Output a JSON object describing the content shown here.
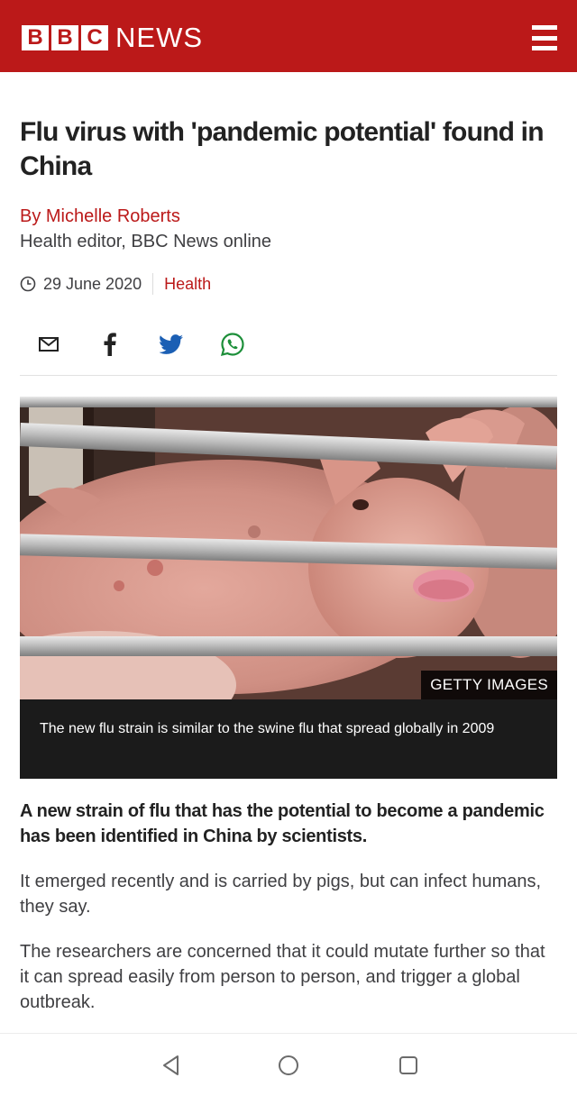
{
  "header": {
    "logo_letters": [
      "B",
      "B",
      "C"
    ],
    "logo_word": "NEWS",
    "menu_icon": "hamburger-menu-icon",
    "background_color": "#bb1919"
  },
  "article": {
    "headline": "Flu virus with 'pandemic potential' found in China",
    "author": "By Michelle Roberts",
    "author_role": "Health editor, BBC News online",
    "date": "29 June 2020",
    "section": "Health",
    "share_icons": [
      "email-icon",
      "facebook-icon",
      "twitter-icon",
      "whatsapp-icon"
    ]
  },
  "media": {
    "image_subject": "pig-behind-metal-bars",
    "credit": "GETTY IMAGES",
    "caption": "The new flu strain is similar to the swine flu that spread globally in 2009"
  },
  "body": {
    "intro": "A new strain of flu that has the potential to become a pandemic has been identified in China by scientists.",
    "paragraphs": [
      "It emerged recently and is carried by pigs, but can infect humans, they say.",
      "The researchers are concerned that it could mutate further so that it can spread easily from person to person, and trigger a global outbreak."
    ]
  },
  "system_nav": {
    "buttons": [
      "back-icon",
      "home-icon",
      "recents-icon"
    ]
  },
  "colors": {
    "accent": "#bb1919",
    "text": "#222222",
    "caption_bg": "#1b1b1b"
  }
}
